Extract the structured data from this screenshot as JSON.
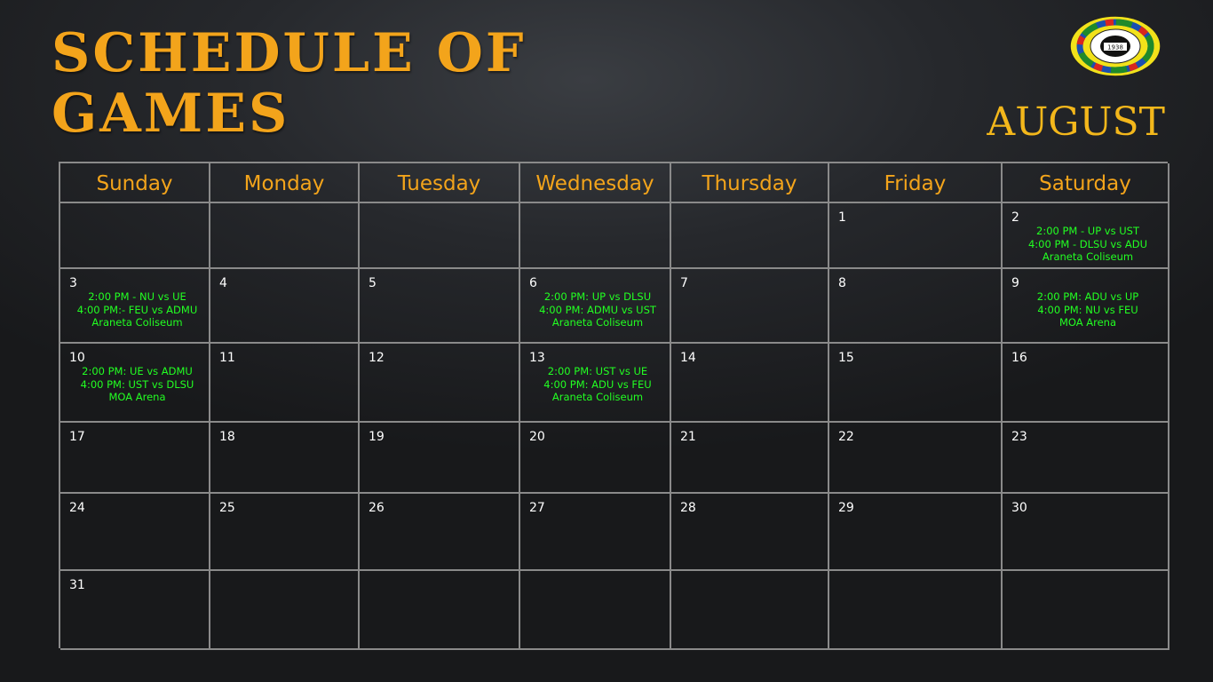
{
  "title": "Schedule of Games",
  "month": "AUGUST",
  "logo": {
    "icon": "league-seal-icon",
    "year": "1938"
  },
  "colors": {
    "accent": "#f3a41b",
    "game_text": "#22ff22",
    "grid": "#8a8a8a",
    "day_number": "#ffffff"
  },
  "weekdays": [
    "Sunday",
    "Monday",
    "Tuesday",
    "Wednesday",
    "Thursday",
    "Friday",
    "Saturday"
  ],
  "weeks": [
    [
      {
        "day": "",
        "games": []
      },
      {
        "day": "",
        "games": []
      },
      {
        "day": "",
        "games": []
      },
      {
        "day": "",
        "games": []
      },
      {
        "day": "",
        "games": []
      },
      {
        "day": "1",
        "games": []
      },
      {
        "day": "2",
        "games": [
          "2:00 PM - UP vs UST",
          "4:00 PM -  DLSU vs ADU",
          "Araneta Coliseum"
        ]
      }
    ],
    [
      {
        "day": "3",
        "games": [
          "2:00 PM - NU vs UE",
          "4:00 PM:- FEU vs ADMU",
          "Araneta Coliseum"
        ]
      },
      {
        "day": "4",
        "games": []
      },
      {
        "day": "5",
        "games": []
      },
      {
        "day": "6",
        "games": [
          "2:00 PM: UP vs DLSU",
          "4:00 PM: ADMU vs UST",
          "Araneta Coliseum"
        ]
      },
      {
        "day": "7",
        "games": []
      },
      {
        "day": "8",
        "games": []
      },
      {
        "day": "9",
        "games": [
          "2:00 PM: ADU vs UP",
          "4:00 PM: NU vs FEU",
          "MOA Arena"
        ]
      }
    ],
    [
      {
        "day": "10",
        "games": [
          "2:00 PM: UE vs ADMU",
          "4:00 PM: UST vs DLSU",
          "MOA Arena"
        ]
      },
      {
        "day": "11",
        "games": []
      },
      {
        "day": "12",
        "games": []
      },
      {
        "day": "13",
        "games": [
          "2:00 PM: UST vs UE",
          "4:00 PM: ADU vs FEU",
          "Araneta Coliseum"
        ]
      },
      {
        "day": "14",
        "games": []
      },
      {
        "day": "15",
        "games": []
      },
      {
        "day": "16",
        "games": []
      }
    ],
    [
      {
        "day": "17",
        "games": []
      },
      {
        "day": "18",
        "games": []
      },
      {
        "day": "19",
        "games": []
      },
      {
        "day": "20",
        "games": []
      },
      {
        "day": "21",
        "games": []
      },
      {
        "day": "22",
        "games": []
      },
      {
        "day": "23",
        "games": []
      }
    ],
    [
      {
        "day": "24",
        "games": []
      },
      {
        "day": "25",
        "games": []
      },
      {
        "day": "26",
        "games": []
      },
      {
        "day": "27",
        "games": []
      },
      {
        "day": "28",
        "games": []
      },
      {
        "day": "29",
        "games": []
      },
      {
        "day": "30",
        "games": []
      }
    ],
    [
      {
        "day": "31",
        "games": []
      },
      {
        "day": "",
        "games": []
      },
      {
        "day": "",
        "games": []
      },
      {
        "day": "",
        "games": []
      },
      {
        "day": "",
        "games": []
      },
      {
        "day": "",
        "games": []
      },
      {
        "day": "",
        "games": []
      }
    ]
  ]
}
